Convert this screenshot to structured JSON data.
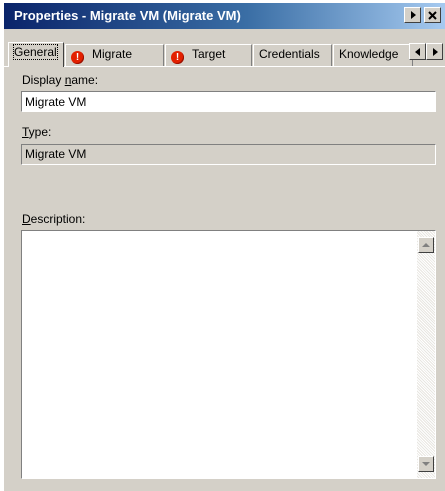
{
  "window": {
    "title": "Properties - Migrate VM (Migrate VM)"
  },
  "tabs": [
    {
      "label": "General",
      "active": true,
      "warning": false
    },
    {
      "label": "Migrate",
      "active": false,
      "warning": true
    },
    {
      "label": "Target",
      "active": false,
      "warning": true
    },
    {
      "label": "Credentials",
      "active": false,
      "warning": false
    },
    {
      "label": "Knowledge",
      "active": false,
      "warning": false
    }
  ],
  "form": {
    "display_name": {
      "label_pre": "Display ",
      "label_key": "n",
      "label_post": "ame:",
      "value": "Migrate VM"
    },
    "type": {
      "label_key": "T",
      "label_post": "ype:",
      "value": "Migrate VM"
    },
    "description": {
      "label_key": "D",
      "label_post": "escription:",
      "value": ""
    }
  },
  "colors": {
    "title_gradient_start": "#0a246a",
    "title_gradient_end": "#a6caf0",
    "dialog_face": "#d4d0c8",
    "warning_icon": "#e32000"
  },
  "icons": {
    "warning": "exclamation-circle",
    "menu": "triangle-right",
    "close": "x"
  }
}
